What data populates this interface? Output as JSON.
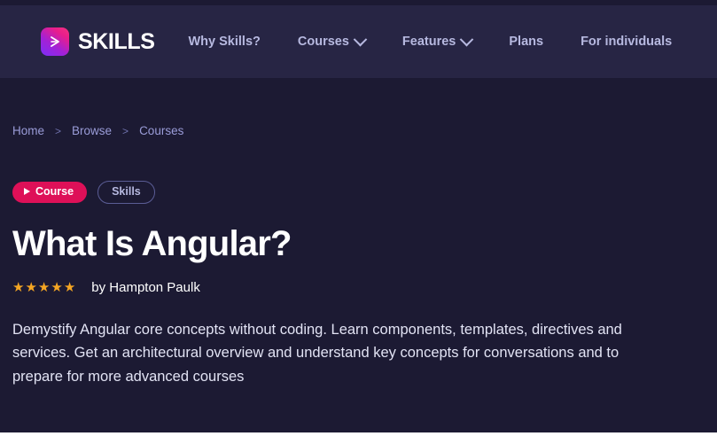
{
  "colors": {
    "header_bg": "#272544",
    "body_bg": "#1c1a33",
    "accent_pink": "#de1058",
    "nav_text": "#b7b9e0",
    "star": "#f5a623",
    "logo_gradient_from": "#7b2ff7",
    "logo_gradient_to": "#f5317f"
  },
  "header": {
    "logo_icon": "play-chevron-icon",
    "brand": "SKILLS",
    "nav": [
      {
        "label": "Why Skills?",
        "has_caret": false
      },
      {
        "label": "Courses",
        "has_caret": true
      },
      {
        "label": "Features",
        "has_caret": true
      },
      {
        "label": "Plans",
        "has_caret": false
      },
      {
        "label": "For individuals",
        "has_caret": false
      }
    ]
  },
  "breadcrumb": {
    "items": [
      "Home",
      "Browse",
      "Courses"
    ],
    "separator": ">"
  },
  "hero": {
    "badges": {
      "course": "Course",
      "course_icon": "play-triangle-icon",
      "skills": "Skills"
    },
    "title": "What Is Angular?",
    "rating": {
      "stars_filled": 5,
      "star_glyph": "★"
    },
    "author": "by Hampton Paulk",
    "description": "Demystify Angular core concepts without coding. Learn components, templates, directives and services. Get an architectural overview and understand key concepts for conversations and to prepare for more advanced courses"
  }
}
